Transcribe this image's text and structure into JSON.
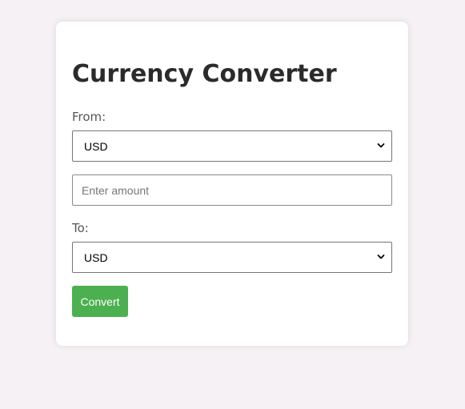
{
  "converter": {
    "title": "Currency Converter",
    "from_label": "From:",
    "from_value": "USD",
    "amount_placeholder": "Enter amount",
    "amount_value": "",
    "to_label": "To:",
    "to_value": "USD",
    "convert_label": "Convert"
  },
  "colors": {
    "background": "#f5f1f4",
    "card": "#ffffff",
    "button": "#4caf50",
    "title": "#2b2b2b"
  }
}
